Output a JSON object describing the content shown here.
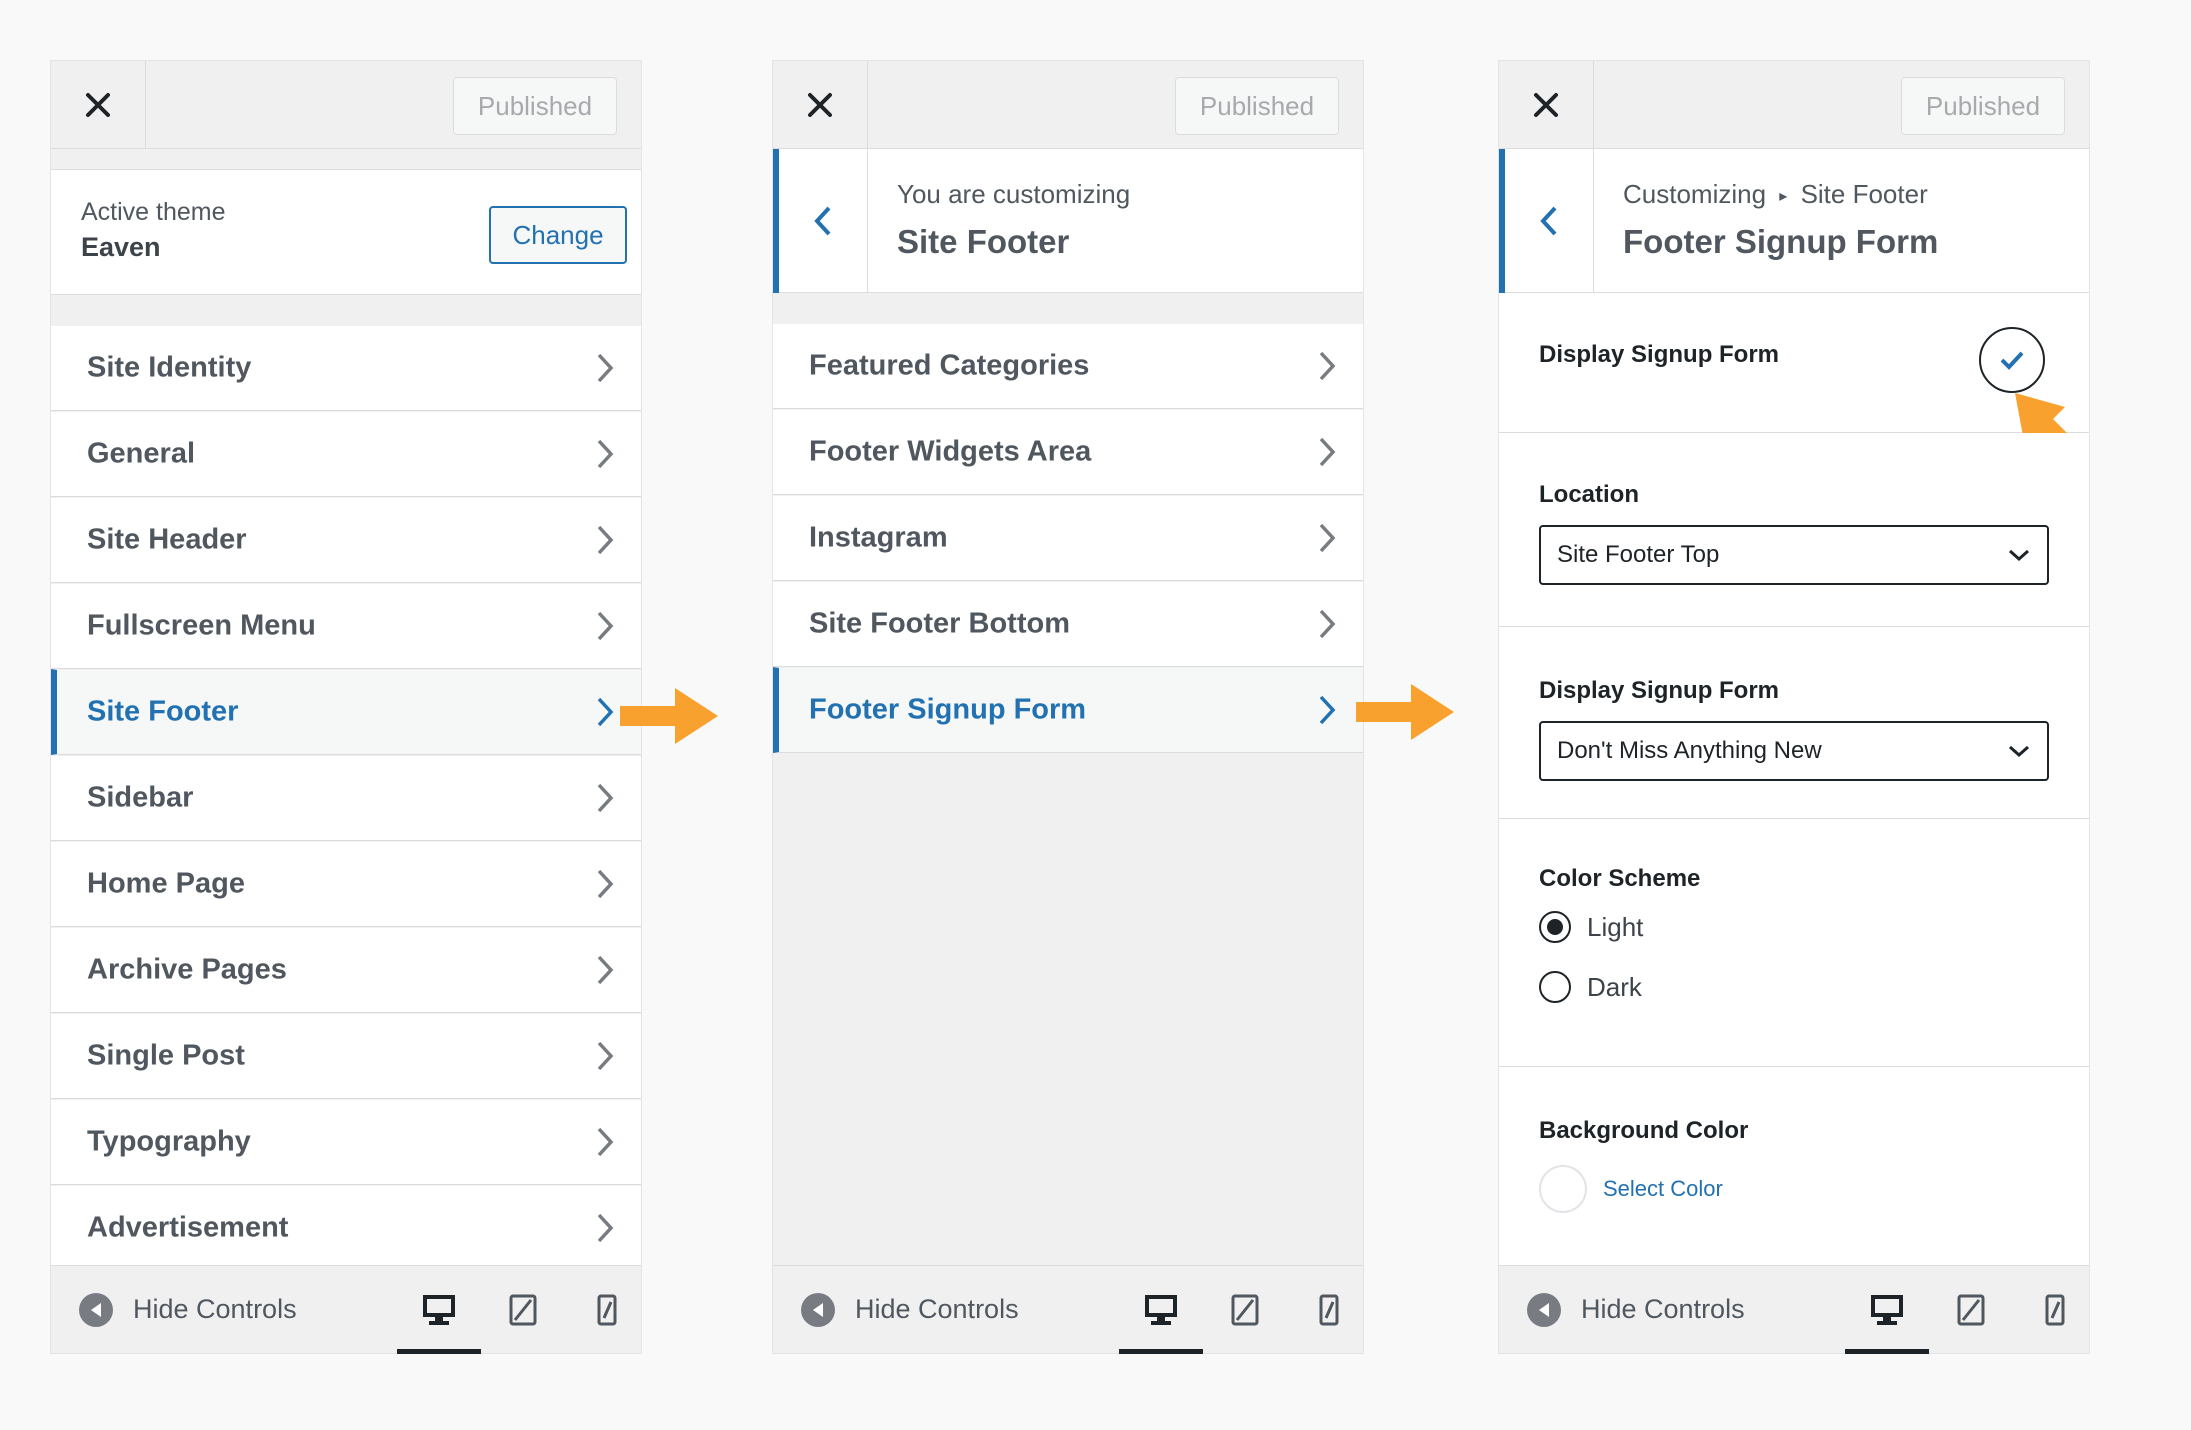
{
  "common": {
    "published_label": "Published",
    "hide_controls_label": "Hide Controls"
  },
  "panel1": {
    "theme_label": "Active theme",
    "theme_name": "Eaven",
    "change_label": "Change",
    "items": [
      {
        "label": "Site Identity"
      },
      {
        "label": "General"
      },
      {
        "label": "Site Header"
      },
      {
        "label": "Fullscreen Menu"
      },
      {
        "label": "Site Footer",
        "active": true
      },
      {
        "label": "Sidebar"
      },
      {
        "label": "Home Page"
      },
      {
        "label": "Archive Pages"
      },
      {
        "label": "Single Post"
      },
      {
        "label": "Typography"
      },
      {
        "label": "Advertisement"
      }
    ]
  },
  "panel2": {
    "kicker": "You are customizing",
    "title": "Site Footer",
    "items": [
      {
        "label": "Featured Categories"
      },
      {
        "label": "Footer Widgets Area"
      },
      {
        "label": "Instagram"
      },
      {
        "label": "Site Footer Bottom"
      },
      {
        "label": "Footer Signup Form",
        "active": true
      }
    ]
  },
  "panel3": {
    "kicker_parent": "Customizing",
    "kicker_sep": "▸",
    "kicker_section": "Site Footer",
    "title": "Footer Signup Form",
    "display_toggle_label": "Display Signup Form",
    "display_toggle_checked": true,
    "location_label": "Location",
    "location_value": "Site Footer Top",
    "form_label": "Display Signup Form",
    "form_value": "Don't Miss Anything New",
    "scheme_label": "Color Scheme",
    "scheme_options": [
      "Light",
      "Dark"
    ],
    "scheme_selected": "Light",
    "bg_label": "Background Color",
    "select_color_label": "Select Color"
  },
  "colors": {
    "accent": "#2271b1",
    "arrow": "#f9a12e",
    "panel_bg": "#f0f0f1"
  }
}
